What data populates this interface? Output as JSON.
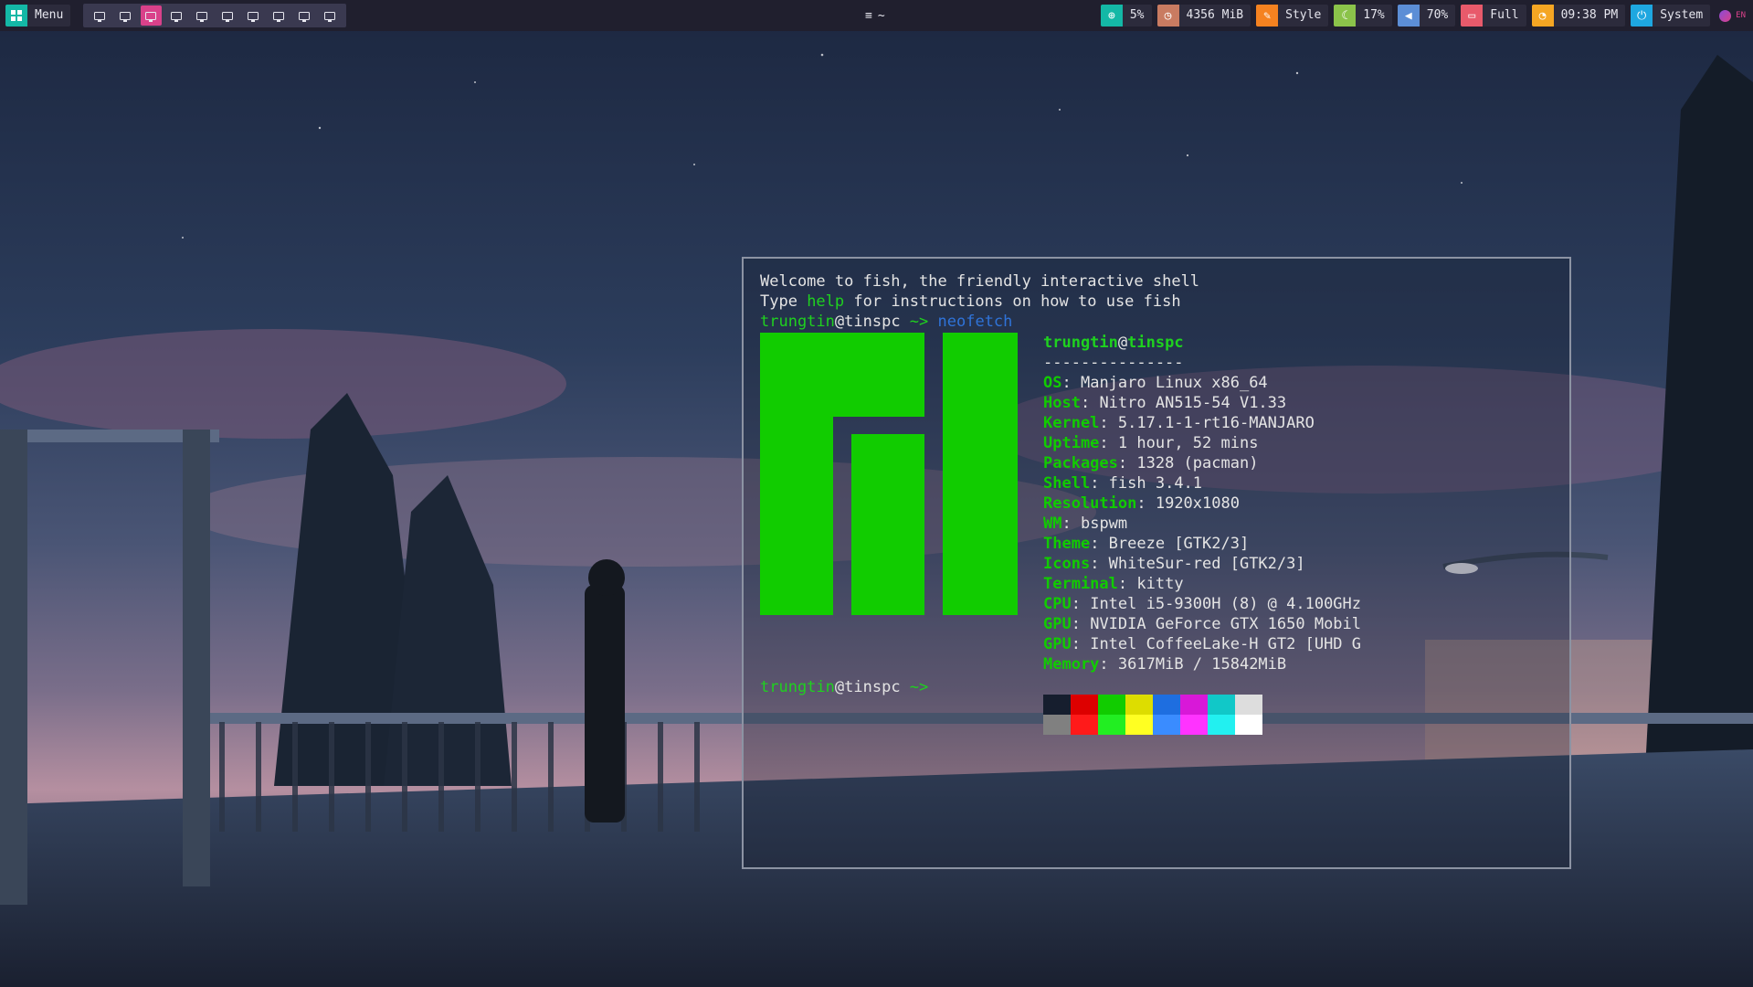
{
  "topbar": {
    "menu": {
      "label": "Menu",
      "icon": "grid-icon",
      "color": "#14b8a6"
    },
    "workspaces": [
      {
        "id": "ws1",
        "active": false
      },
      {
        "id": "ws2",
        "active": false
      },
      {
        "id": "ws3",
        "active": true
      },
      {
        "id": "ws4",
        "active": false
      },
      {
        "id": "ws5",
        "active": false
      },
      {
        "id": "ws6",
        "active": false
      },
      {
        "id": "ws7",
        "active": false
      },
      {
        "id": "ws8",
        "active": false
      },
      {
        "id": "ws9",
        "active": false
      },
      {
        "id": "ws10",
        "active": false
      }
    ],
    "window_title": "~",
    "modules": {
      "network": {
        "value": "5%",
        "icon": "globe-icon",
        "color": "#14b8a6"
      },
      "memory": {
        "value": "4356 MiB",
        "icon": "memory-icon",
        "color": "#c97b61"
      },
      "style": {
        "value": "Style",
        "icon": "brush-icon",
        "color": "#f58220"
      },
      "brightness": {
        "value": "17%",
        "icon": "moon-icon",
        "color": "#8bc34a"
      },
      "volume": {
        "value": "70%",
        "icon": "speaker-icon",
        "color": "#5c8ed6"
      },
      "battery": {
        "value": "Full",
        "icon": "battery-icon",
        "color": "#e85a6b"
      },
      "clock": {
        "value": "09:38 PM",
        "icon": "clock-icon",
        "color": "#f5a623"
      },
      "system": {
        "value": "System",
        "icon": "power-icon",
        "color": "#1ea7e0"
      }
    },
    "language": "EN"
  },
  "terminal": {
    "welcome": "Welcome to fish, the friendly interactive shell",
    "help_prefix": "Type ",
    "help_word": "help",
    "help_suffix": " for instructions on how to use fish",
    "prompt_user": "trungtin",
    "prompt_at": "@",
    "prompt_host": "tinspc",
    "prompt_dir": " ~> ",
    "command": "neofetch",
    "neofetch": {
      "user": "trungtin",
      "at": "@",
      "host": "tinspc",
      "separator": "---------------",
      "fields": [
        {
          "key": "OS",
          "value": "Manjaro Linux x86_64"
        },
        {
          "key": "Host",
          "value": "Nitro AN515-54 V1.33"
        },
        {
          "key": "Kernel",
          "value": "5.17.1-1-rt16-MANJARO"
        },
        {
          "key": "Uptime",
          "value": "1 hour, 52 mins"
        },
        {
          "key": "Packages",
          "value": "1328 (pacman)"
        },
        {
          "key": "Shell",
          "value": "fish 3.4.1"
        },
        {
          "key": "Resolution",
          "value": "1920x1080"
        },
        {
          "key": "WM",
          "value": "bspwm"
        },
        {
          "key": "Theme",
          "value": "Breeze [GTK2/3]"
        },
        {
          "key": "Icons",
          "value": "WhiteSur-red [GTK2/3]"
        },
        {
          "key": "Terminal",
          "value": "kitty"
        },
        {
          "key": "CPU",
          "value": "Intel i5-9300H (8) @ 4.100GHz"
        },
        {
          "key": "GPU",
          "value": "NVIDIA GeForce GTX 1650 Mobil"
        },
        {
          "key": "GPU",
          "value": "Intel CoffeeLake-H GT2 [UHD G"
        },
        {
          "key": "Memory",
          "value": "3617MiB / 15842MiB"
        }
      ],
      "palette_dark": [
        "#161e2e",
        "#dd0000",
        "#11cc00",
        "#dddd00",
        "#1e6ee0",
        "#d818d8",
        "#11c8c8",
        "#dddddd"
      ],
      "palette_bright": [
        "#808080",
        "#ff1a1a",
        "#22ee22",
        "#ffff22",
        "#3a8cff",
        "#ff33ff",
        "#22f0f0",
        "#ffffff"
      ]
    },
    "final_prompt_dir": " ~>"
  }
}
